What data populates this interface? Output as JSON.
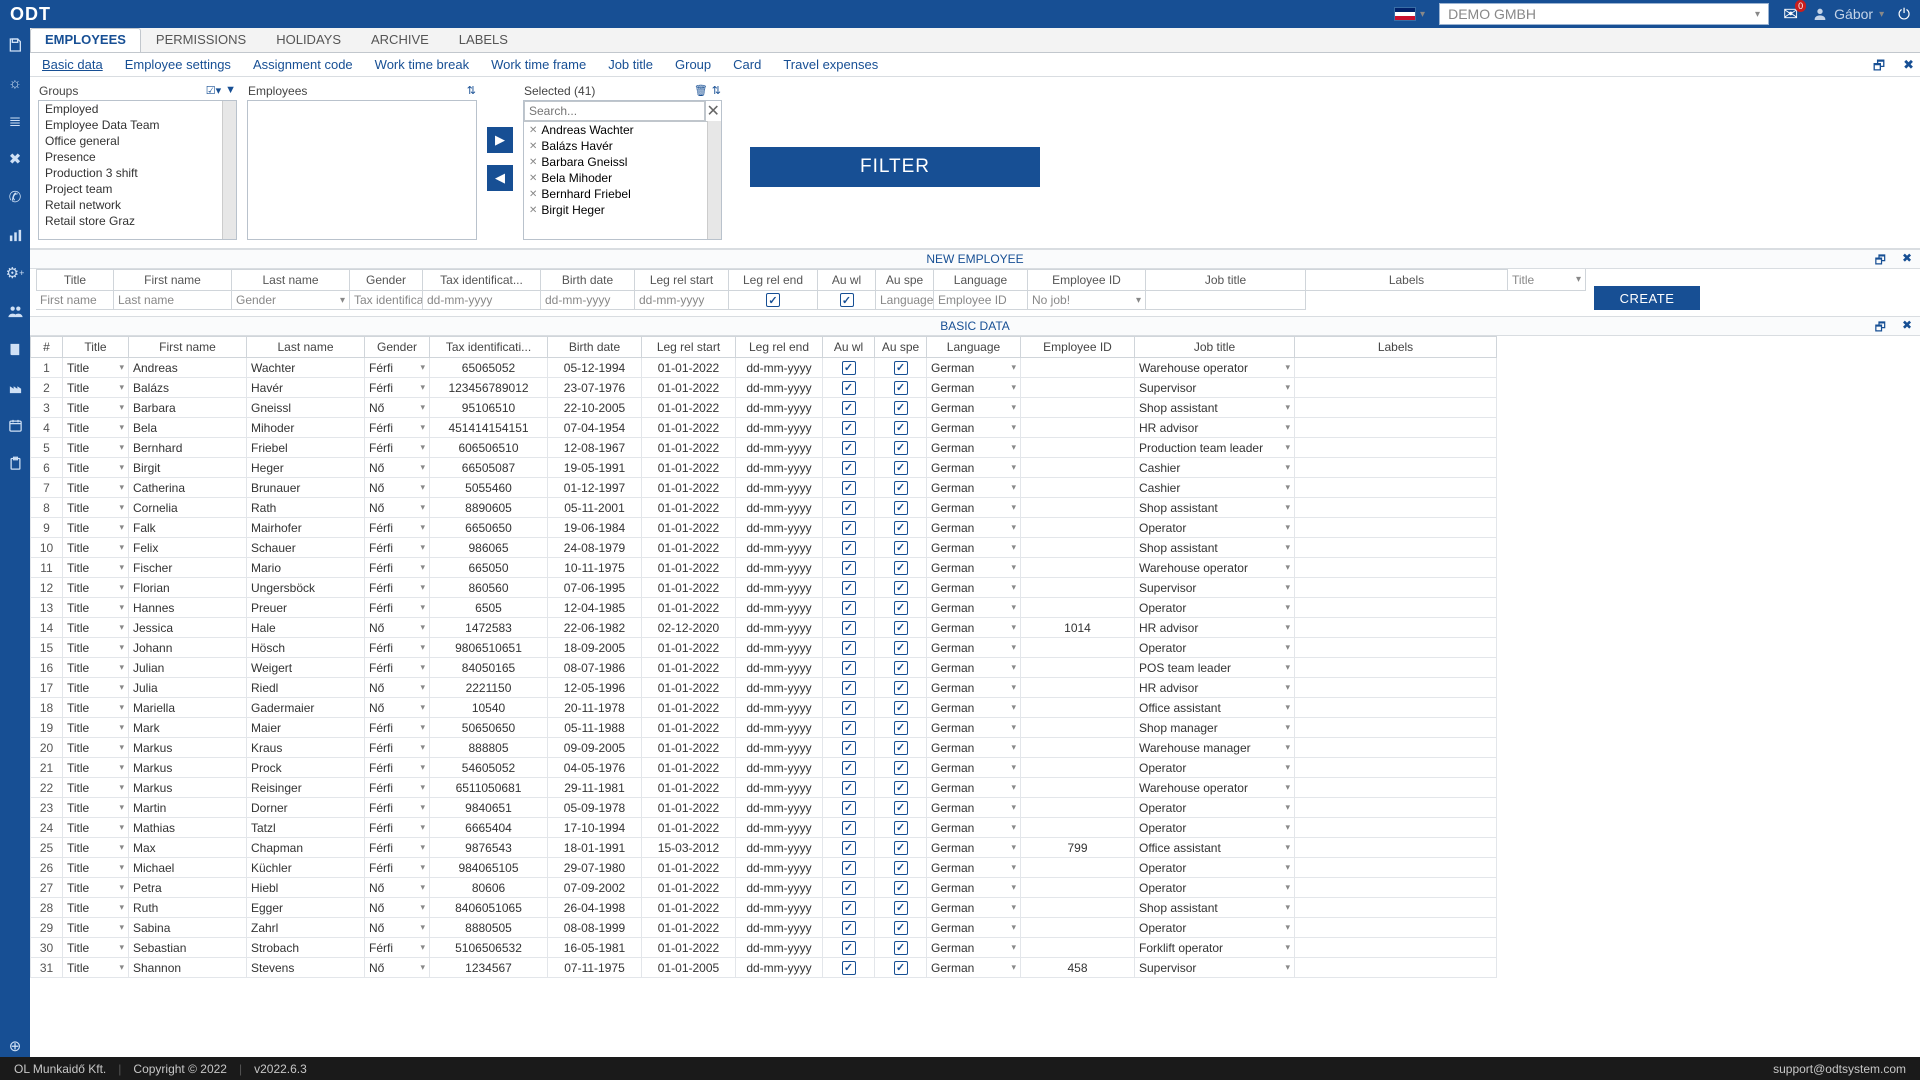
{
  "header": {
    "logo": "ODT",
    "company_placeholder": "DEMO GMBH",
    "notif_count": "0",
    "user_name": "Gábor"
  },
  "tabs": [
    "EMPLOYEES",
    "PERMISSIONS",
    "HOLIDAYS",
    "ARCHIVE",
    "LABELS"
  ],
  "subtabs": [
    "Basic data",
    "Employee settings",
    "Assignment code",
    "Work time break",
    "Work time frame",
    "Job title",
    "Group",
    "Card",
    "Travel expenses"
  ],
  "filter": {
    "groups_label": "Groups",
    "groups": [
      "Employed",
      "Employee Data Team",
      "Office general",
      "Presence",
      "Production 3 shift",
      "Project team",
      "Retail network",
      "Retail store Graz"
    ],
    "employees_label": "Employees",
    "selected_label": "Selected (41)",
    "search_placeholder": "Search...",
    "selected": [
      "Andreas Wachter",
      "Balázs Havér",
      "Barbara Gneissl",
      "Bela Mihoder",
      "Bernhard Friebel",
      "Birgit Heger"
    ],
    "filter_btn": "FILTER"
  },
  "new_emp": {
    "title": "NEW EMPLOYEE",
    "headers": [
      "Title",
      "First name",
      "Last name",
      "Gender",
      "Tax identificat...",
      "Birth date",
      "Leg rel start",
      "Leg rel end",
      "Au wl",
      "Au spe",
      "Language",
      "Employee ID",
      "Job title",
      "Labels"
    ],
    "inputs": {
      "title": "Title",
      "first": "First name",
      "last": "Last name",
      "gender": "Gender",
      "tax": "Tax identification ...",
      "birth": "dd-mm-yyyy",
      "start": "dd-mm-yyyy",
      "end": "dd-mm-yyyy",
      "lang": "Language",
      "empid": "Employee ID",
      "job": "No job!"
    },
    "create": "CREATE"
  },
  "basic": {
    "title": "BASIC DATA",
    "headers": [
      "#",
      "Title",
      "First name",
      "Last name",
      "Gender",
      "Tax identificati...",
      "Birth date",
      "Leg rel start",
      "Leg rel end",
      "Au wl",
      "Au spe",
      "Language",
      "Employee ID",
      "Job title",
      "Labels"
    ],
    "dd_end_ph": "dd-mm-yyyy",
    "rows": [
      {
        "n": 1,
        "t": "Title",
        "fn": "Andreas",
        "ln": "Wachter",
        "g": "Férfi",
        "tax": "65065052",
        "bd": "05-12-1994",
        "st": "01-01-2022",
        "lang": "German",
        "eid": "",
        "job": "Warehouse operator"
      },
      {
        "n": 2,
        "t": "Title",
        "fn": "Balázs",
        "ln": "Havér",
        "g": "Férfi",
        "tax": "123456789012",
        "bd": "23-07-1976",
        "st": "01-01-2022",
        "lang": "German",
        "eid": "",
        "job": "Supervisor"
      },
      {
        "n": 3,
        "t": "Title",
        "fn": "Barbara",
        "ln": "Gneissl",
        "g": "Nő",
        "tax": "95106510",
        "bd": "22-10-2005",
        "st": "01-01-2022",
        "lang": "German",
        "eid": "",
        "job": "Shop assistant"
      },
      {
        "n": 4,
        "t": "Title",
        "fn": "Bela",
        "ln": "Mihoder",
        "g": "Férfi",
        "tax": "451414154151",
        "bd": "07-04-1954",
        "st": "01-01-2022",
        "lang": "German",
        "eid": "",
        "job": "HR advisor"
      },
      {
        "n": 5,
        "t": "Title",
        "fn": "Bernhard",
        "ln": "Friebel",
        "g": "Férfi",
        "tax": "606506510",
        "bd": "12-08-1967",
        "st": "01-01-2022",
        "lang": "German",
        "eid": "",
        "job": "Production team leader"
      },
      {
        "n": 6,
        "t": "Title",
        "fn": "Birgit",
        "ln": "Heger",
        "g": "Nő",
        "tax": "66505087",
        "bd": "19-05-1991",
        "st": "01-01-2022",
        "lang": "German",
        "eid": "",
        "job": "Cashier"
      },
      {
        "n": 7,
        "t": "Title",
        "fn": "Catherina",
        "ln": "Brunauer",
        "g": "Nő",
        "tax": "5055460",
        "bd": "01-12-1997",
        "st": "01-01-2022",
        "lang": "German",
        "eid": "",
        "job": "Cashier"
      },
      {
        "n": 8,
        "t": "Title",
        "fn": "Cornelia",
        "ln": "Rath",
        "g": "Nő",
        "tax": "8890605",
        "bd": "05-11-2001",
        "st": "01-01-2022",
        "lang": "German",
        "eid": "",
        "job": "Shop assistant"
      },
      {
        "n": 9,
        "t": "Title",
        "fn": "Falk",
        "ln": "Mairhofer",
        "g": "Férfi",
        "tax": "6650650",
        "bd": "19-06-1984",
        "st": "01-01-2022",
        "lang": "German",
        "eid": "",
        "job": "Operator"
      },
      {
        "n": 10,
        "t": "Title",
        "fn": "Felix",
        "ln": "Schauer",
        "g": "Férfi",
        "tax": "986065",
        "bd": "24-08-1979",
        "st": "01-01-2022",
        "lang": "German",
        "eid": "",
        "job": "Shop assistant"
      },
      {
        "n": 11,
        "t": "Title",
        "fn": "Fischer",
        "ln": "Mario",
        "g": "Férfi",
        "tax": "665050",
        "bd": "10-11-1975",
        "st": "01-01-2022",
        "lang": "German",
        "eid": "",
        "job": "Warehouse operator"
      },
      {
        "n": 12,
        "t": "Title",
        "fn": "Florian",
        "ln": "Ungersböck",
        "g": "Férfi",
        "tax": "860560",
        "bd": "07-06-1995",
        "st": "01-01-2022",
        "lang": "German",
        "eid": "",
        "job": "Supervisor"
      },
      {
        "n": 13,
        "t": "Title",
        "fn": "Hannes",
        "ln": "Preuer",
        "g": "Férfi",
        "tax": "6505",
        "bd": "12-04-1985",
        "st": "01-01-2022",
        "lang": "German",
        "eid": "",
        "job": "Operator"
      },
      {
        "n": 14,
        "t": "Title",
        "fn": "Jessica",
        "ln": "Hale",
        "g": "Nő",
        "tax": "1472583",
        "bd": "22-06-1982",
        "st": "02-12-2020",
        "lang": "German",
        "eid": "1014",
        "job": "HR advisor"
      },
      {
        "n": 15,
        "t": "Title",
        "fn": "Johann",
        "ln": "Hösch",
        "g": "Férfi",
        "tax": "9806510651",
        "bd": "18-09-2005",
        "st": "01-01-2022",
        "lang": "German",
        "eid": "",
        "job": "Operator"
      },
      {
        "n": 16,
        "t": "Title",
        "fn": "Julian",
        "ln": "Weigert",
        "g": "Férfi",
        "tax": "84050165",
        "bd": "08-07-1986",
        "st": "01-01-2022",
        "lang": "German",
        "eid": "",
        "job": "POS team leader"
      },
      {
        "n": 17,
        "t": "Title",
        "fn": "Julia",
        "ln": "Riedl",
        "g": "Nő",
        "tax": "2221150",
        "bd": "12-05-1996",
        "st": "01-01-2022",
        "lang": "German",
        "eid": "",
        "job": "HR advisor"
      },
      {
        "n": 18,
        "t": "Title",
        "fn": "Mariella",
        "ln": "Gadermaier",
        "g": "Nő",
        "tax": "10540",
        "bd": "20-11-1978",
        "st": "01-01-2022",
        "lang": "German",
        "eid": "",
        "job": "Office assistant"
      },
      {
        "n": 19,
        "t": "Title",
        "fn": "Mark",
        "ln": "Maier",
        "g": "Férfi",
        "tax": "50650650",
        "bd": "05-11-1988",
        "st": "01-01-2022",
        "lang": "German",
        "eid": "",
        "job": "Shop manager"
      },
      {
        "n": 20,
        "t": "Title",
        "fn": "Markus",
        "ln": "Kraus",
        "g": "Férfi",
        "tax": "888805",
        "bd": "09-09-2005",
        "st": "01-01-2022",
        "lang": "German",
        "eid": "",
        "job": "Warehouse manager"
      },
      {
        "n": 21,
        "t": "Title",
        "fn": "Markus",
        "ln": "Prock",
        "g": "Férfi",
        "tax": "54605052",
        "bd": "04-05-1976",
        "st": "01-01-2022",
        "lang": "German",
        "eid": "",
        "job": "Operator"
      },
      {
        "n": 22,
        "t": "Title",
        "fn": "Markus",
        "ln": "Reisinger",
        "g": "Férfi",
        "tax": "6511050681",
        "bd": "29-11-1981",
        "st": "01-01-2022",
        "lang": "German",
        "eid": "",
        "job": "Warehouse operator"
      },
      {
        "n": 23,
        "t": "Title",
        "fn": "Martin",
        "ln": "Dorner",
        "g": "Férfi",
        "tax": "9840651",
        "bd": "05-09-1978",
        "st": "01-01-2022",
        "lang": "German",
        "eid": "",
        "job": "Operator"
      },
      {
        "n": 24,
        "t": "Title",
        "fn": "Mathias",
        "ln": "Tatzl",
        "g": "Férfi",
        "tax": "6665404",
        "bd": "17-10-1994",
        "st": "01-01-2022",
        "lang": "German",
        "eid": "",
        "job": "Operator"
      },
      {
        "n": 25,
        "t": "Title",
        "fn": "Max",
        "ln": "Chapman",
        "g": "Férfi",
        "tax": "9876543",
        "bd": "18-01-1991",
        "st": "15-03-2012",
        "lang": "German",
        "eid": "799",
        "job": "Office assistant"
      },
      {
        "n": 26,
        "t": "Title",
        "fn": "Michael",
        "ln": "Küchler",
        "g": "Férfi",
        "tax": "984065105",
        "bd": "29-07-1980",
        "st": "01-01-2022",
        "lang": "German",
        "eid": "",
        "job": "Operator"
      },
      {
        "n": 27,
        "t": "Title",
        "fn": "Petra",
        "ln": "Hiebl",
        "g": "Nő",
        "tax": "80606",
        "bd": "07-09-2002",
        "st": "01-01-2022",
        "lang": "German",
        "eid": "",
        "job": "Operator"
      },
      {
        "n": 28,
        "t": "Title",
        "fn": "Ruth",
        "ln": "Egger",
        "g": "Nő",
        "tax": "8406051065",
        "bd": "26-04-1998",
        "st": "01-01-2022",
        "lang": "German",
        "eid": "",
        "job": "Shop assistant"
      },
      {
        "n": 29,
        "t": "Title",
        "fn": "Sabina",
        "ln": "Zahrl",
        "g": "Nő",
        "tax": "8880505",
        "bd": "08-08-1999",
        "st": "01-01-2022",
        "lang": "German",
        "eid": "",
        "job": "Operator"
      },
      {
        "n": 30,
        "t": "Title",
        "fn": "Sebastian",
        "ln": "Strobach",
        "g": "Férfi",
        "tax": "5106506532",
        "bd": "16-05-1981",
        "st": "01-01-2022",
        "lang": "German",
        "eid": "",
        "job": "Forklift operator"
      },
      {
        "n": 31,
        "t": "Title",
        "fn": "Shannon",
        "ln": "Stevens",
        "g": "Nő",
        "tax": "1234567",
        "bd": "07-11-1975",
        "st": "01-01-2005",
        "lang": "German",
        "eid": "458",
        "job": "Supervisor"
      }
    ]
  },
  "footer": {
    "company": "OL Munkaidő Kft.",
    "copyright": "Copyright © 2022",
    "version": "v2022.6.3",
    "support": "support@odtsystem.com"
  }
}
